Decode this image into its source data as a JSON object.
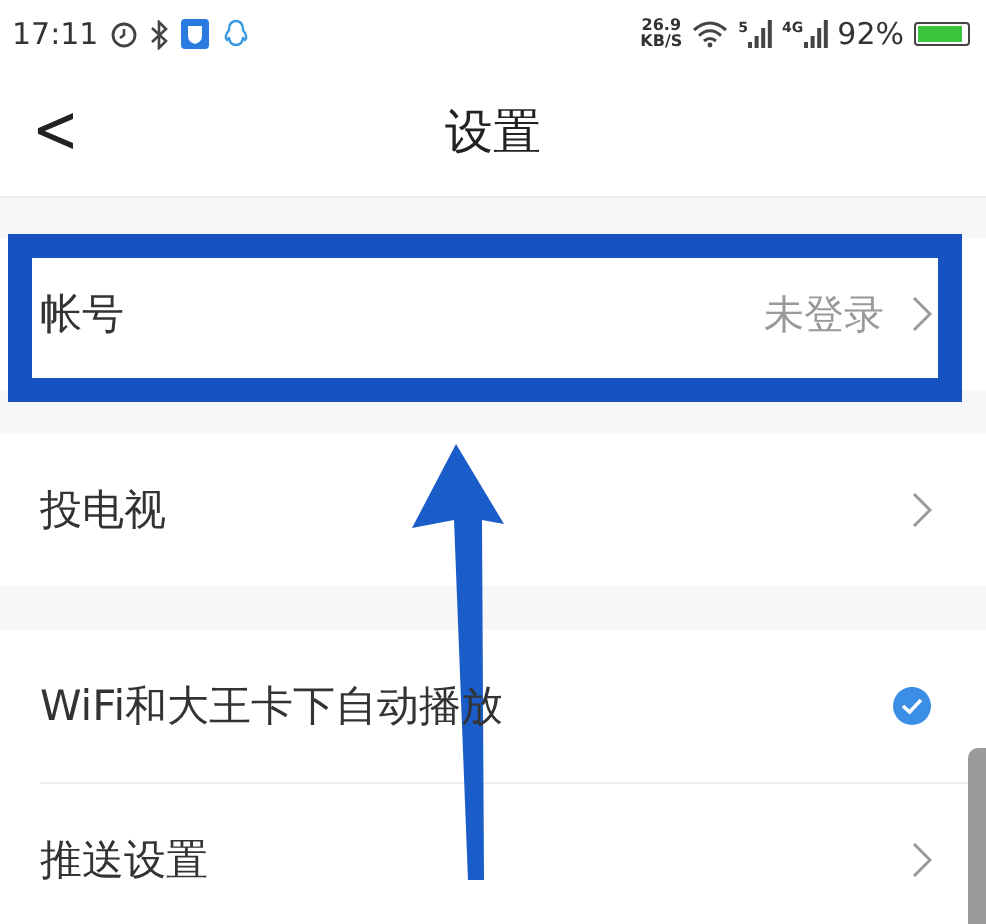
{
  "status_bar": {
    "time": "17:11",
    "net_speed": "26.9",
    "net_speed_unit": "KB/S",
    "sim1_label": "5",
    "sim2_label": "4G",
    "battery": "92%"
  },
  "header": {
    "back": "<",
    "title": "设置"
  },
  "groups": [
    {
      "rows": [
        {
          "kind": "link",
          "label": "帐号",
          "value": "未登录"
        }
      ]
    },
    {
      "rows": [
        {
          "kind": "link",
          "label": "投电视"
        }
      ]
    },
    {
      "rows": [
        {
          "kind": "check",
          "label": "WiFi和大王卡下自动播放",
          "checked": true
        },
        {
          "kind": "link",
          "label": "推送设置"
        }
      ]
    }
  ]
}
